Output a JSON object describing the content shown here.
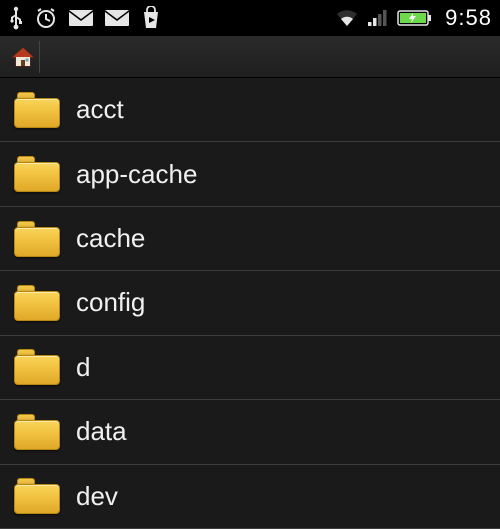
{
  "status": {
    "time": "9:58"
  },
  "folders": [
    {
      "name": "acct"
    },
    {
      "name": "app-cache"
    },
    {
      "name": "cache"
    },
    {
      "name": "config"
    },
    {
      "name": "d"
    },
    {
      "name": "data"
    },
    {
      "name": "dev"
    }
  ]
}
